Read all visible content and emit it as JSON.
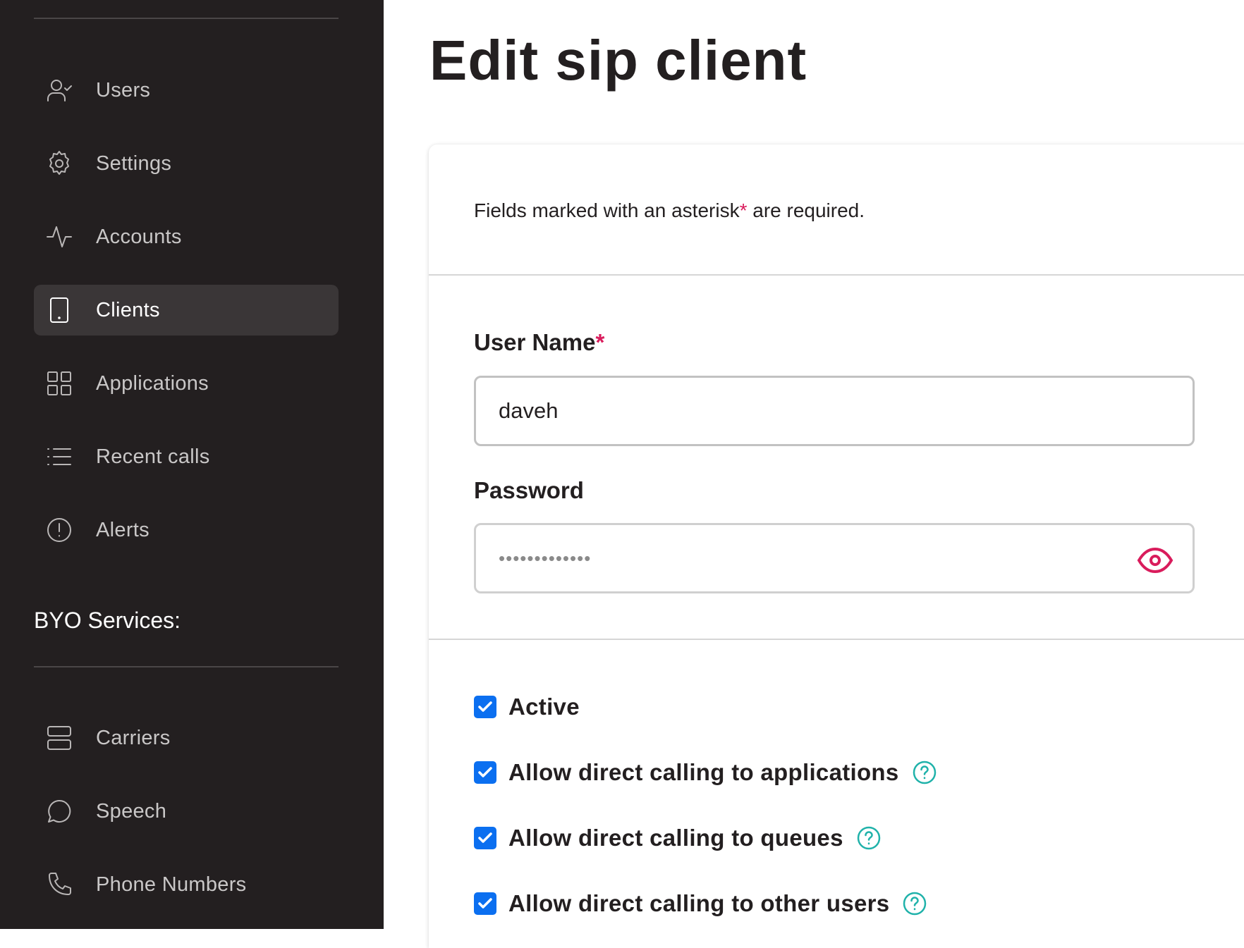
{
  "sidebar": {
    "items": [
      {
        "label": "Users",
        "icon": "users-icon"
      },
      {
        "label": "Settings",
        "icon": "gear-icon"
      },
      {
        "label": "Accounts",
        "icon": "activity-icon"
      },
      {
        "label": "Clients",
        "icon": "tablet-icon",
        "active": true
      },
      {
        "label": "Applications",
        "icon": "grid-icon"
      },
      {
        "label": "Recent calls",
        "icon": "list-icon"
      },
      {
        "label": "Alerts",
        "icon": "alert-circle-icon"
      }
    ],
    "byo_title": "BYO Services:",
    "byo_items": [
      {
        "label": "Carriers",
        "icon": "server-icon"
      },
      {
        "label": "Speech",
        "icon": "chat-bubble-icon"
      },
      {
        "label": "Phone Numbers",
        "icon": "phone-icon"
      }
    ]
  },
  "page": {
    "title": "Edit sip client"
  },
  "form": {
    "note_text": "Fields marked with an asterisk",
    "note_asterisk": "*",
    "note_suffix": " are required.",
    "username_label": "User Name",
    "username_required": "*",
    "username_value": "daveh",
    "password_label": "Password",
    "password_value": "•••••••••••••",
    "checkboxes": [
      {
        "label": "Active",
        "checked": true,
        "help": false
      },
      {
        "label": "Allow direct calling to applications",
        "checked": true,
        "help": true
      },
      {
        "label": "Allow direct calling to queues",
        "checked": true,
        "help": true
      },
      {
        "label": "Allow direct calling to other users",
        "checked": true,
        "help": true
      }
    ]
  },
  "colors": {
    "sidebar_bg": "#231f20",
    "accent_required": "#d91c5c",
    "checkbox_blue": "#0b6ff0",
    "help_teal": "#20b2aa"
  }
}
